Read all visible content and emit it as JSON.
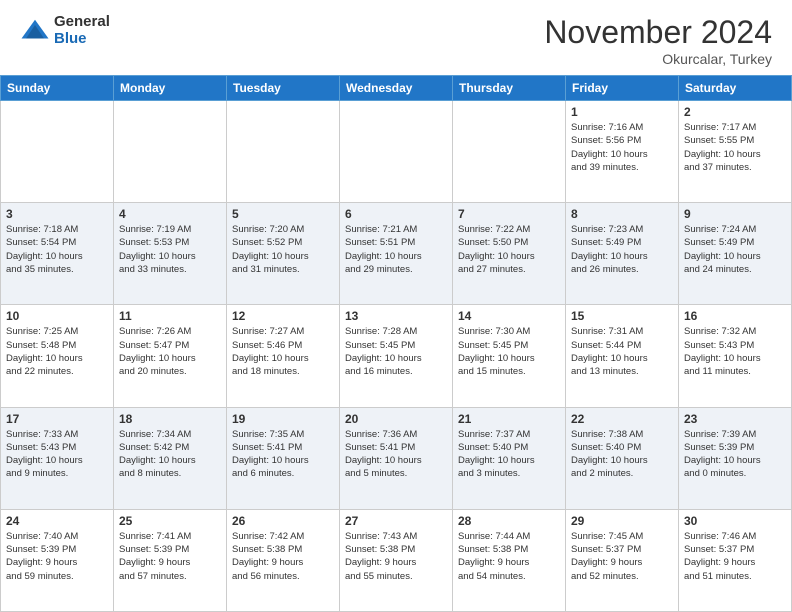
{
  "header": {
    "logo_general": "General",
    "logo_blue": "Blue",
    "month_title": "November 2024",
    "location": "Okurcalar, Turkey"
  },
  "weekdays": [
    "Sunday",
    "Monday",
    "Tuesday",
    "Wednesday",
    "Thursday",
    "Friday",
    "Saturday"
  ],
  "weeks": [
    [
      {
        "day": "",
        "info": ""
      },
      {
        "day": "",
        "info": ""
      },
      {
        "day": "",
        "info": ""
      },
      {
        "day": "",
        "info": ""
      },
      {
        "day": "",
        "info": ""
      },
      {
        "day": "1",
        "info": "Sunrise: 7:16 AM\nSunset: 5:56 PM\nDaylight: 10 hours\nand 39 minutes."
      },
      {
        "day": "2",
        "info": "Sunrise: 7:17 AM\nSunset: 5:55 PM\nDaylight: 10 hours\nand 37 minutes."
      }
    ],
    [
      {
        "day": "3",
        "info": "Sunrise: 7:18 AM\nSunset: 5:54 PM\nDaylight: 10 hours\nand 35 minutes."
      },
      {
        "day": "4",
        "info": "Sunrise: 7:19 AM\nSunset: 5:53 PM\nDaylight: 10 hours\nand 33 minutes."
      },
      {
        "day": "5",
        "info": "Sunrise: 7:20 AM\nSunset: 5:52 PM\nDaylight: 10 hours\nand 31 minutes."
      },
      {
        "day": "6",
        "info": "Sunrise: 7:21 AM\nSunset: 5:51 PM\nDaylight: 10 hours\nand 29 minutes."
      },
      {
        "day": "7",
        "info": "Sunrise: 7:22 AM\nSunset: 5:50 PM\nDaylight: 10 hours\nand 27 minutes."
      },
      {
        "day": "8",
        "info": "Sunrise: 7:23 AM\nSunset: 5:49 PM\nDaylight: 10 hours\nand 26 minutes."
      },
      {
        "day": "9",
        "info": "Sunrise: 7:24 AM\nSunset: 5:49 PM\nDaylight: 10 hours\nand 24 minutes."
      }
    ],
    [
      {
        "day": "10",
        "info": "Sunrise: 7:25 AM\nSunset: 5:48 PM\nDaylight: 10 hours\nand 22 minutes."
      },
      {
        "day": "11",
        "info": "Sunrise: 7:26 AM\nSunset: 5:47 PM\nDaylight: 10 hours\nand 20 minutes."
      },
      {
        "day": "12",
        "info": "Sunrise: 7:27 AM\nSunset: 5:46 PM\nDaylight: 10 hours\nand 18 minutes."
      },
      {
        "day": "13",
        "info": "Sunrise: 7:28 AM\nSunset: 5:45 PM\nDaylight: 10 hours\nand 16 minutes."
      },
      {
        "day": "14",
        "info": "Sunrise: 7:30 AM\nSunset: 5:45 PM\nDaylight: 10 hours\nand 15 minutes."
      },
      {
        "day": "15",
        "info": "Sunrise: 7:31 AM\nSunset: 5:44 PM\nDaylight: 10 hours\nand 13 minutes."
      },
      {
        "day": "16",
        "info": "Sunrise: 7:32 AM\nSunset: 5:43 PM\nDaylight: 10 hours\nand 11 minutes."
      }
    ],
    [
      {
        "day": "17",
        "info": "Sunrise: 7:33 AM\nSunset: 5:43 PM\nDaylight: 10 hours\nand 9 minutes."
      },
      {
        "day": "18",
        "info": "Sunrise: 7:34 AM\nSunset: 5:42 PM\nDaylight: 10 hours\nand 8 minutes."
      },
      {
        "day": "19",
        "info": "Sunrise: 7:35 AM\nSunset: 5:41 PM\nDaylight: 10 hours\nand 6 minutes."
      },
      {
        "day": "20",
        "info": "Sunrise: 7:36 AM\nSunset: 5:41 PM\nDaylight: 10 hours\nand 5 minutes."
      },
      {
        "day": "21",
        "info": "Sunrise: 7:37 AM\nSunset: 5:40 PM\nDaylight: 10 hours\nand 3 minutes."
      },
      {
        "day": "22",
        "info": "Sunrise: 7:38 AM\nSunset: 5:40 PM\nDaylight: 10 hours\nand 2 minutes."
      },
      {
        "day": "23",
        "info": "Sunrise: 7:39 AM\nSunset: 5:39 PM\nDaylight: 10 hours\nand 0 minutes."
      }
    ],
    [
      {
        "day": "24",
        "info": "Sunrise: 7:40 AM\nSunset: 5:39 PM\nDaylight: 9 hours\nand 59 minutes."
      },
      {
        "day": "25",
        "info": "Sunrise: 7:41 AM\nSunset: 5:39 PM\nDaylight: 9 hours\nand 57 minutes."
      },
      {
        "day": "26",
        "info": "Sunrise: 7:42 AM\nSunset: 5:38 PM\nDaylight: 9 hours\nand 56 minutes."
      },
      {
        "day": "27",
        "info": "Sunrise: 7:43 AM\nSunset: 5:38 PM\nDaylight: 9 hours\nand 55 minutes."
      },
      {
        "day": "28",
        "info": "Sunrise: 7:44 AM\nSunset: 5:38 PM\nDaylight: 9 hours\nand 54 minutes."
      },
      {
        "day": "29",
        "info": "Sunrise: 7:45 AM\nSunset: 5:37 PM\nDaylight: 9 hours\nand 52 minutes."
      },
      {
        "day": "30",
        "info": "Sunrise: 7:46 AM\nSunset: 5:37 PM\nDaylight: 9 hours\nand 51 minutes."
      }
    ]
  ]
}
